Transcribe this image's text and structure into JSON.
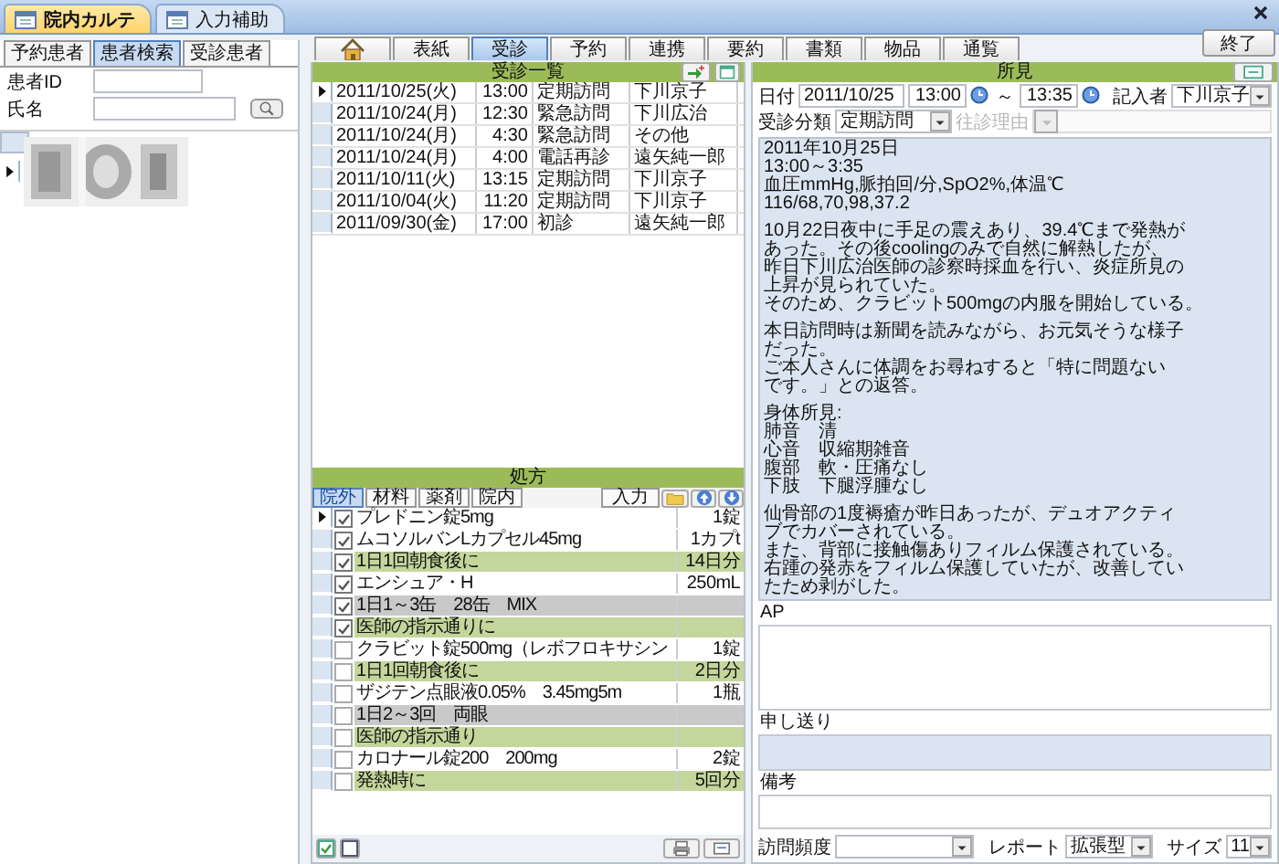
{
  "window_tabs": [
    {
      "label": "院内カルテ",
      "selected": true
    },
    {
      "label": "入力補助",
      "selected": false
    }
  ],
  "left_tabs": [
    {
      "label": "予約患者",
      "selected": false
    },
    {
      "label": "患者検索",
      "selected": true
    },
    {
      "label": "受診患者",
      "selected": false
    }
  ],
  "patient_search": {
    "id_label": "患者ID",
    "name_label": "氏名"
  },
  "patient_list": [
    {
      "selected": true,
      "kind": "picture"
    }
  ],
  "nav_tabs": [
    {
      "kind": "home",
      "selected": false
    },
    {
      "kind": "text",
      "label": "表紙",
      "selected": false
    },
    {
      "kind": "text",
      "label": "受診",
      "selected": true
    },
    {
      "kind": "text",
      "label": "予約",
      "selected": false
    },
    {
      "kind": "text",
      "label": "連携",
      "selected": false
    },
    {
      "kind": "text",
      "label": "要約",
      "selected": false
    },
    {
      "kind": "text",
      "label": "書類",
      "selected": false
    },
    {
      "kind": "text",
      "label": "物品",
      "selected": false
    },
    {
      "kind": "text",
      "label": "通覧",
      "selected": false
    }
  ],
  "exit_button": "終了",
  "visit_list": {
    "title": "受診一覧",
    "rows": [
      {
        "date": "2011/10/25(火)",
        "time": "13:00",
        "type": "定期訪問",
        "staff": "下川京子",
        "selected": true
      },
      {
        "date": "2011/10/24(月)",
        "time": "12:30",
        "type": "緊急訪問",
        "staff": "下川広治",
        "selected": false
      },
      {
        "date": "2011/10/24(月)",
        "time": "4:30",
        "type": "緊急訪問",
        "staff": "その他",
        "selected": false
      },
      {
        "date": "2011/10/24(月)",
        "time": "4:00",
        "type": "電話再診",
        "staff": "遠矢純一郎",
        "selected": false
      },
      {
        "date": "2011/10/11(火)",
        "time": "13:15",
        "type": "定期訪問",
        "staff": "下川京子",
        "selected": false
      },
      {
        "date": "2011/10/04(火)",
        "time": "11:20",
        "type": "定期訪問",
        "staff": "下川京子",
        "selected": false
      },
      {
        "date": "2011/09/30(金)",
        "time": "17:00",
        "type": "初診",
        "staff": "遠矢純一郎",
        "selected": false
      }
    ]
  },
  "prescription": {
    "title": "処方",
    "tabs": [
      {
        "label": "院外",
        "selected": true
      },
      {
        "label": "材料",
        "selected": false
      },
      {
        "label": "薬剤",
        "selected": false
      },
      {
        "label": "院内",
        "selected": false
      }
    ],
    "input_button": "入力",
    "rows": [
      {
        "kind": "drug",
        "checked": true,
        "selected": true,
        "name": "プレドニン錠5mg",
        "qty": "1錠"
      },
      {
        "kind": "drug",
        "checked": true,
        "selected": false,
        "name": "ムコソルバンLカプセル45mg",
        "qty": "1カプt"
      },
      {
        "kind": "usage",
        "checked": true,
        "selected": false,
        "name": "1日1回朝食後に",
        "qty": "14日分"
      },
      {
        "kind": "drug",
        "checked": true,
        "selected": false,
        "name": "エンシュア・H",
        "qty": "250mL"
      },
      {
        "kind": "comment",
        "checked": true,
        "selected": false,
        "name": "1日1～3缶　28缶　MIX"
      },
      {
        "kind": "usage",
        "checked": true,
        "selected": false,
        "name": "医師の指示通りに"
      },
      {
        "kind": "drug",
        "checked": false,
        "selected": false,
        "name": "クラビット錠500mg（レボフロキサシン",
        "qty": "1錠"
      },
      {
        "kind": "usage",
        "checked": false,
        "selected": false,
        "name": "1日1回朝食後に",
        "qty": "2日分"
      },
      {
        "kind": "drug",
        "checked": false,
        "selected": false,
        "name": "ザジテン点眼液0.05%　3.45mg5m",
        "qty": "1瓶"
      },
      {
        "kind": "comment",
        "checked": false,
        "selected": false,
        "name": "1日2～3回　両眼"
      },
      {
        "kind": "usage",
        "checked": false,
        "selected": false,
        "name": "医師の指示通り"
      },
      {
        "kind": "drug",
        "checked": false,
        "selected": false,
        "name": "カロナール錠200　200mg",
        "qty": "2錠"
      },
      {
        "kind": "usage",
        "checked": false,
        "selected": false,
        "name": "発熱時に",
        "qty": "5回分"
      }
    ]
  },
  "findings": {
    "title": "所見",
    "date_label": "日付",
    "date": "2011/10/25",
    "start_time": "13:00",
    "tilde": "～",
    "end_time": "13:35",
    "author_label": "記入者",
    "author": "下川京子",
    "category_label": "受診分類",
    "category": "定期訪問",
    "reason_label": "往診理由",
    "reason_disabled": true,
    "note": [
      [
        "2011年10月25日",
        "13:00～3:35",
        "血圧mmHg,脈拍回/分,SpO2%,体温℃",
        "116/68,70,98,37.2"
      ],
      [
        "10月22日夜中に手足の震えあり、39.4℃まで発熱が",
        "あった。その後coolingのみで自然に解熱したが、",
        "昨日下川広治医師の診察時採血を行い、炎症所見の",
        "上昇が見られていた。",
        "そのため、クラビット500mgの内服を開始している。"
      ],
      [
        "本日訪問時は新聞を読みながら、お元気そうな様子",
        "だった。",
        "ご本人さんに体調をお尋ねすると「特に問題ない",
        "です。」との返答。"
      ],
      [
        "身体所見:",
        "肺音　清",
        "心音　収縮期雑音",
        "腹部　軟・圧痛なし",
        "下肢　下腿浮腫なし"
      ],
      [
        "仙骨部の1度褥瘡が昨日あったが、デュオアクティ",
        "ブでカバーされている。",
        "また、背部に接触傷ありフィルム保護されている。",
        "右踵の発赤をフィルム保護していたが、改善してい",
        "たため剥がした。"
      ]
    ]
  },
  "ap": {
    "label": "AP"
  },
  "handover": {
    "label": "申し送り"
  },
  "remarks": {
    "label": "備考"
  },
  "footer": {
    "frequency_label": "訪問頻度",
    "report_label": "レポート",
    "report": "拡張型",
    "size_label": "サイズ",
    "size": "11"
  }
}
